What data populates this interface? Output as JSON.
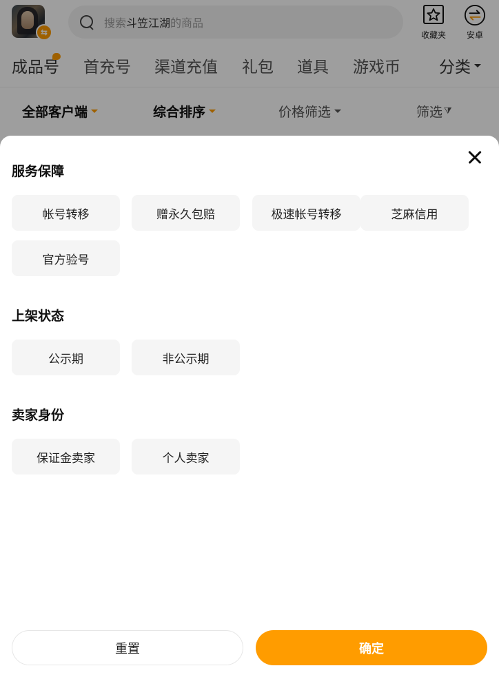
{
  "header": {
    "search": {
      "prefix": "搜索",
      "keyword": "斗笠江湖",
      "suffix": "的商品"
    },
    "actions": [
      {
        "label": "收藏夹",
        "icon": "star-folder-icon"
      },
      {
        "label": "安卓",
        "icon": "swap-icon"
      }
    ]
  },
  "category_tabs": [
    {
      "label": "成品号",
      "active": true
    },
    {
      "label": "首充号"
    },
    {
      "label": "渠道充值"
    },
    {
      "label": "礼包"
    },
    {
      "label": "道具"
    },
    {
      "label": "游戏币"
    }
  ],
  "classify_label": "分类",
  "sort_bar": [
    {
      "label": "全部客户端"
    },
    {
      "label": "综合排序"
    },
    {
      "label": "价格筛选"
    },
    {
      "label": "筛选"
    }
  ],
  "filter_sheet": {
    "sections": [
      {
        "title": "服务保障",
        "options": [
          "帐号转移",
          "赠永久包赔",
          "极速帐号转移",
          "芝麻信用",
          "官方验号"
        ]
      },
      {
        "title": "上架状态",
        "options": [
          "公示期",
          "非公示期"
        ]
      },
      {
        "title": "卖家身份",
        "options": [
          "保证金卖家",
          "个人卖家"
        ]
      }
    ],
    "reset_label": "重置",
    "confirm_label": "确定"
  },
  "colors": {
    "accent": "#ff9c00",
    "chip_bg": "#f5f5f5"
  }
}
